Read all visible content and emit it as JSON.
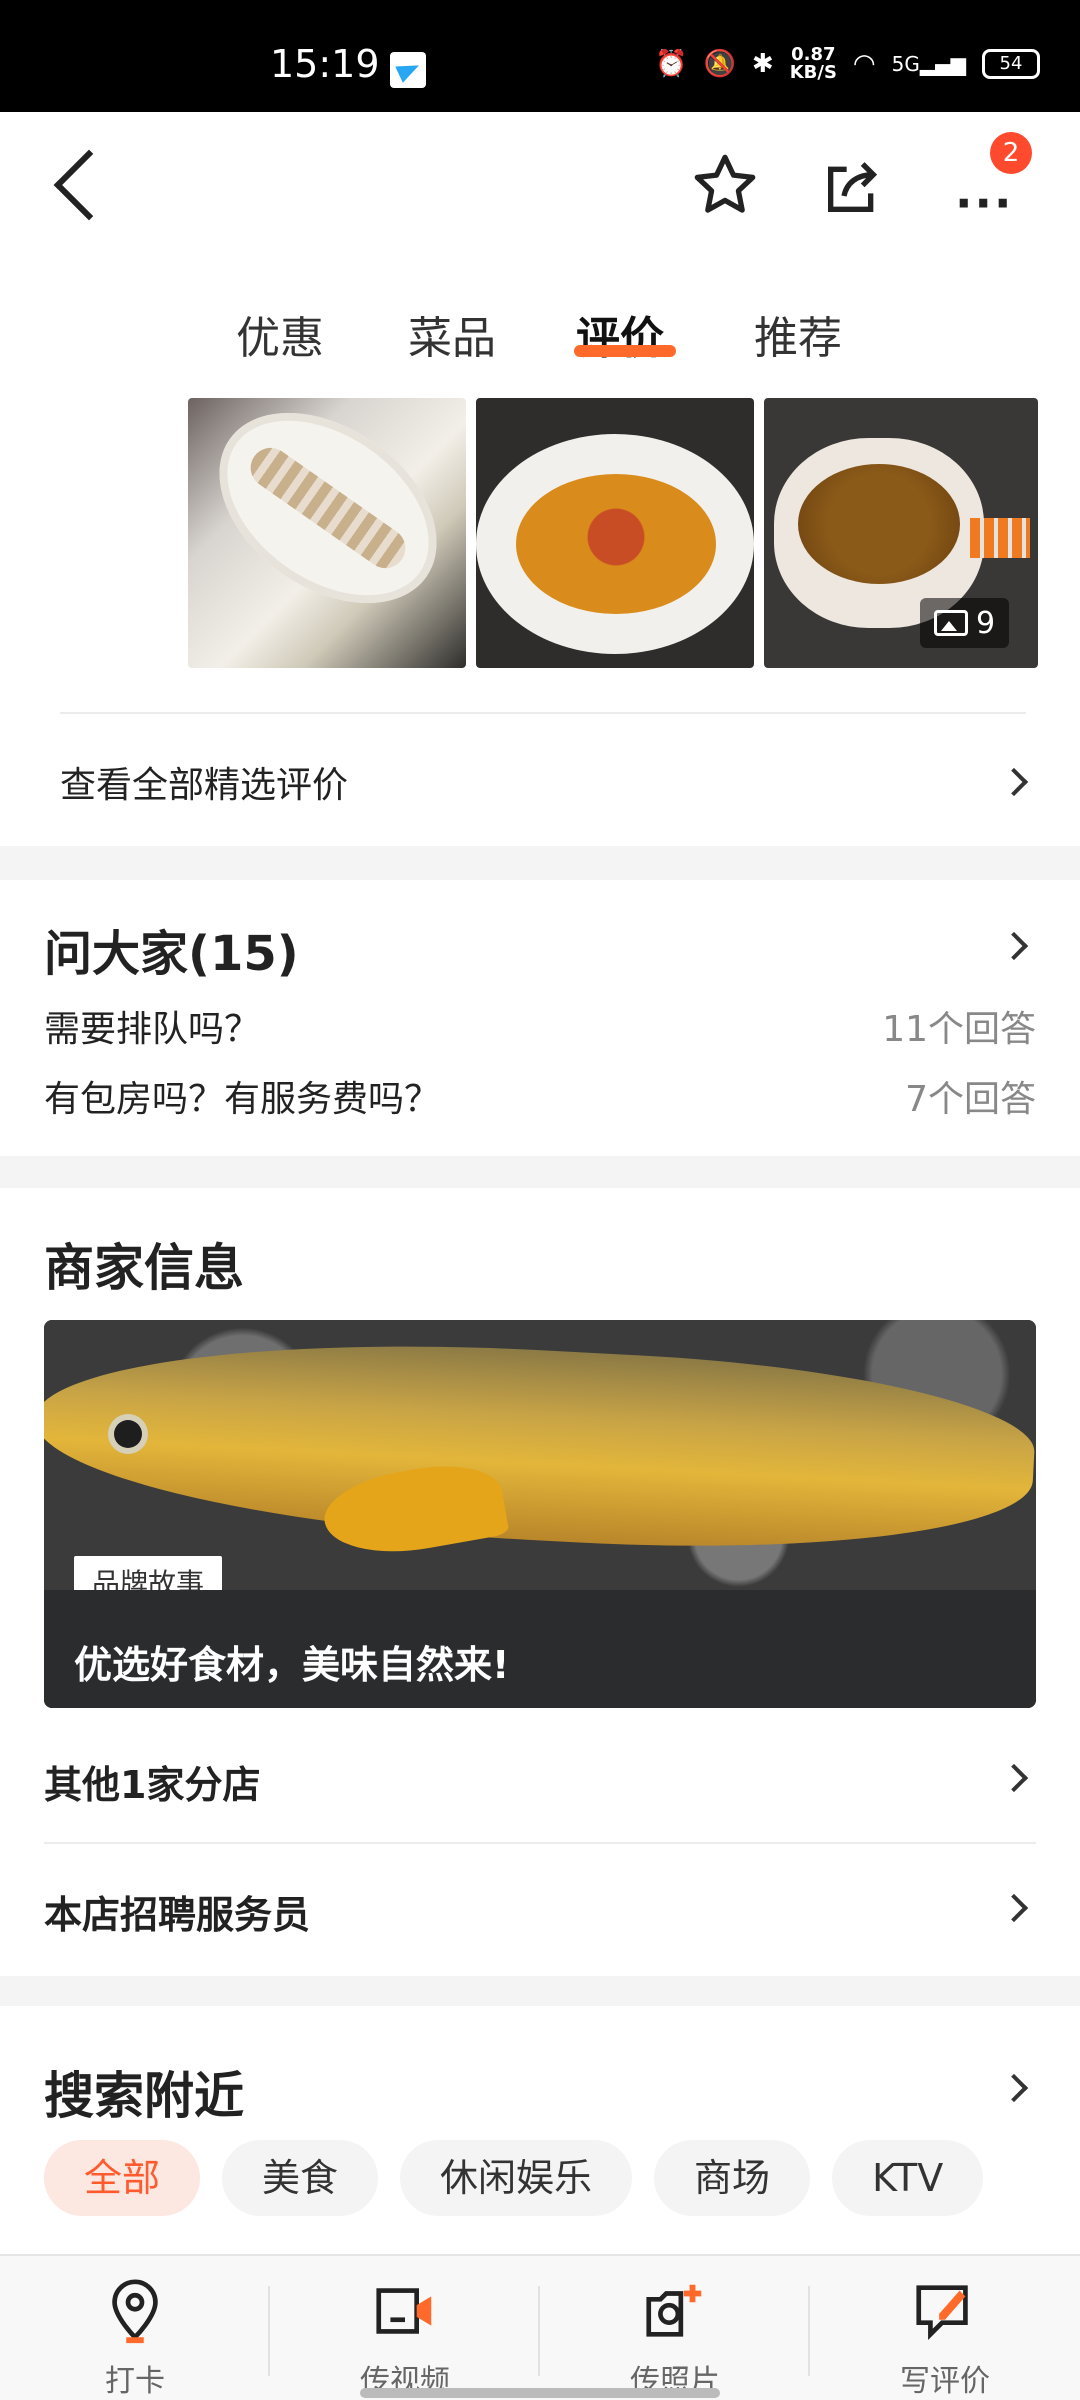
{
  "status_bar": {
    "time": "15:19",
    "speed_value": "0.87",
    "speed_unit": "KB/S",
    "network": "5G",
    "battery": "54"
  },
  "nav": {
    "badge_count": "2",
    "more_label": "···"
  },
  "tabs": [
    "优惠",
    "菜品",
    "评价",
    "推荐"
  ],
  "reviews": {
    "photo_count": "9",
    "all_reviews_label": "查看全部精选评价"
  },
  "ask": {
    "title": "问大家(15)",
    "questions": [
      {
        "q": "需要排队吗？",
        "a": "11个回答"
      },
      {
        "q": "有包房吗？有服务费吗？",
        "a": "7个回答"
      }
    ]
  },
  "merchant": {
    "title": "商家信息",
    "banner_tag": "品牌故事",
    "banner_caption": "优选好食材，美味自然来!",
    "links": [
      "其他1家分店",
      "本店招聘服务员"
    ]
  },
  "nearby": {
    "title": "搜索附近",
    "chips": [
      "全部",
      "美食",
      "休闲娱乐",
      "商场",
      "KTV"
    ]
  },
  "bottom_bar": [
    "打卡",
    "传视频",
    "传照片",
    "写评价"
  ],
  "colors": {
    "accent": "#ff6a2a",
    "badge": "#ff4a2e",
    "chip_active_bg": "#fde7e1"
  }
}
